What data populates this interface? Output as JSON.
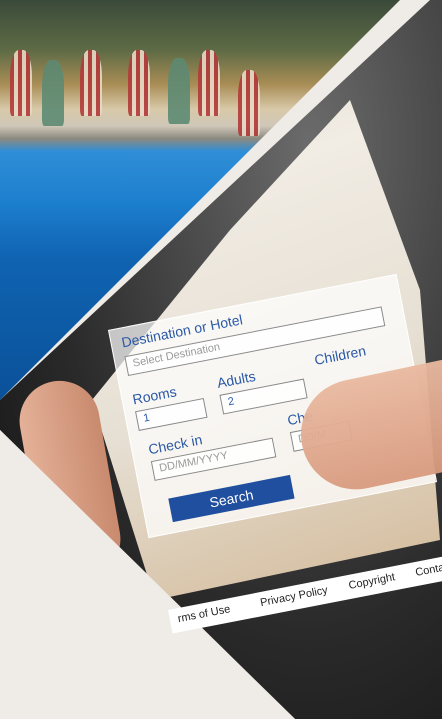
{
  "search_form": {
    "destination_label": "Destination or Hotel",
    "destination_placeholder": "Select Destination",
    "rooms_label": "Rooms",
    "rooms_value": "1",
    "adults_label": "Adults",
    "adults_value": "2",
    "children_label": "Children",
    "checkin_label": "Check in",
    "checkin_placeholder": "DD/MM/YYYY",
    "checkout_label": "Che",
    "checkout_placeholder": "DD/M",
    "search_button": "Search"
  },
  "footer": {
    "links": [
      "rms of Use",
      "Privacy Policy",
      "Copyright",
      "Conta"
    ]
  },
  "colors": {
    "accent": "#1f4f9e",
    "label": "#2a58a6",
    "background": "#efebe7"
  }
}
